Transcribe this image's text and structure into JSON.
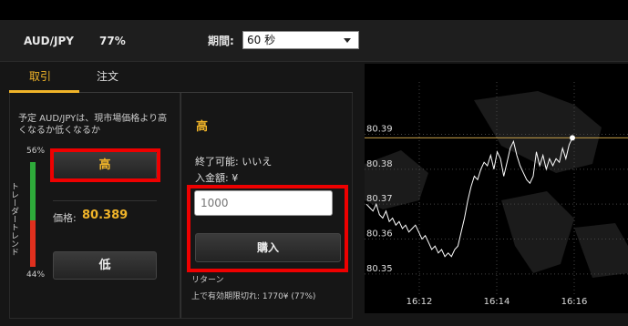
{
  "header": {
    "pair": "AUD/JPY",
    "percent": "77%",
    "period_label": "期間:",
    "period_value": "60 秒"
  },
  "tabs": [
    {
      "label": "取引",
      "active": true
    },
    {
      "label": "注文",
      "active": false
    }
  ],
  "left": {
    "description": "予定 AUD/JPYは、現市場価格より高くなるか低くなるか",
    "trend_label": "トレーダートレンド",
    "high_pct": "56%",
    "low_pct": "44%",
    "high_share": 0.56,
    "high_button": "高",
    "low_button": "低",
    "price_label": "価格:",
    "price_value": "80.389"
  },
  "mid": {
    "title": "高",
    "expire": "終了可能: いいえ",
    "amount_label": "入金額: ¥",
    "amount_placeholder": "1000",
    "buy_button": "購入",
    "return_label": "リターン",
    "return_text": "上で有効期限切れ: 1770¥ (77%)"
  },
  "chart_data": {
    "type": "line",
    "ylim": [
      80.345,
      80.405
    ],
    "y_ticks": [
      "80.39",
      "80.38",
      "80.37",
      "80.36",
      "80.35"
    ],
    "x_ticks": [
      "16:12",
      "16:14",
      "16:16"
    ],
    "reference_line": 80.389,
    "series": [
      {
        "values": [
          80.37,
          80.369,
          80.368,
          80.37,
          80.367,
          80.366,
          80.368,
          80.365,
          80.366,
          80.364,
          80.365,
          80.363,
          80.364,
          80.362,
          80.363,
          80.364,
          80.362,
          80.36,
          80.361,
          80.359,
          80.357,
          80.358,
          80.356,
          80.357,
          80.355,
          80.356,
          80.355,
          80.357,
          80.358,
          80.362,
          80.366,
          80.371,
          80.375,
          80.378,
          80.377,
          80.38,
          80.382,
          80.381,
          80.384,
          80.38,
          80.385,
          80.383,
          80.378,
          80.382,
          80.386,
          80.388,
          80.384,
          80.381,
          80.379,
          80.377,
          80.376,
          80.378,
          80.385,
          80.381,
          80.384,
          80.38,
          80.383,
          80.381,
          80.383,
          80.382,
          80.386,
          80.383,
          80.387,
          80.389
        ]
      }
    ],
    "colors": {
      "line": "#ffffff",
      "reference": "#c9a24a",
      "grid": "#444444"
    }
  }
}
